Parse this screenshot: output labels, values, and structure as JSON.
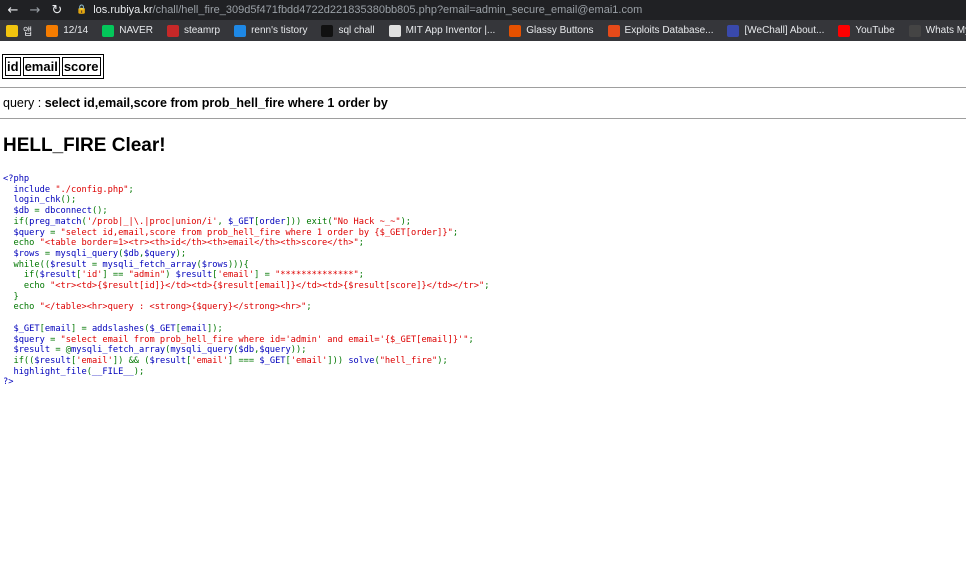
{
  "browser": {
    "url_host": "los.rubiya.kr",
    "url_path": "/chall/hell_fire_309d5f471fbdd4722d221835380bb805.php?email=admin_secure_email@emai1.com",
    "icons": [
      "back-arrow-icon",
      "forward-arrow-icon",
      "reload-icon",
      "lock-icon"
    ]
  },
  "bookmarks": [
    {
      "label": "앱",
      "icon": "apps-grid-icon",
      "color": "#f1c40f"
    },
    {
      "label": "12/14",
      "icon": "blogger-icon",
      "color": "#f57c00"
    },
    {
      "label": "NAVER",
      "icon": "naver-icon",
      "color": "#03c75a"
    },
    {
      "label": "steamrp",
      "icon": "steam-icon",
      "color": "#c62828"
    },
    {
      "label": "renn's tistory",
      "icon": "tistory-icon",
      "color": "#1e88e5"
    },
    {
      "label": "sql chall",
      "icon": "z-icon",
      "color": "#111111"
    },
    {
      "label": "MIT App Inventor |...",
      "icon": "app-inventor-icon",
      "color": "#e0e0e0"
    },
    {
      "label": "Glassy Buttons",
      "icon": "glassy-icon",
      "color": "#e65100"
    },
    {
      "label": "Exploits Database...",
      "icon": "exploitdb-icon",
      "color": "#e64a19"
    },
    {
      "label": "[WeChall] About...",
      "icon": "wechall-icon",
      "color": "#3949ab"
    },
    {
      "label": "YouTube",
      "icon": "youtube-icon",
      "color": "#ff0000"
    },
    {
      "label": "Whats My IP Addr...",
      "icon": "whatsmyip-icon",
      "color": "#444444"
    }
  ],
  "table": {
    "headers": [
      "id",
      "email",
      "score"
    ]
  },
  "query": {
    "label": "query : ",
    "value": "select id,email,score from prob_hell_fire where 1 order by"
  },
  "heading": "HELL_FIRE Clear!",
  "source_lines": [
    {
      "seg": [
        [
          "tag",
          "<?php"
        ]
      ]
    },
    {
      "seg": [
        [
          "tag",
          "  include "
        ],
        [
          "str",
          "\"./config.php\""
        ],
        [
          "kw",
          ";"
        ]
      ]
    },
    {
      "seg": [
        [
          "tag",
          "  login_chk"
        ],
        [
          "kw",
          "();"
        ]
      ]
    },
    {
      "seg": [
        [
          "tag",
          "  $db "
        ],
        [
          "kw",
          "= "
        ],
        [
          "tag",
          "dbconnect"
        ],
        [
          "kw",
          "();"
        ]
      ]
    },
    {
      "seg": [
        [
          "kw",
          "  if("
        ],
        [
          "tag",
          "preg_match"
        ],
        [
          "kw",
          "("
        ],
        [
          "str",
          "'/prob|_|\\.|proc|union/i'"
        ],
        [
          "kw",
          ", "
        ],
        [
          "tag",
          "$_GET"
        ],
        [
          "kw",
          "["
        ],
        [
          "tag",
          "order"
        ],
        [
          "kw",
          "])) exit("
        ],
        [
          "str",
          "\"No Hack ~_~\""
        ],
        [
          "kw",
          ");"
        ]
      ]
    },
    {
      "seg": [
        [
          "tag",
          "  $query "
        ],
        [
          "kw",
          "= "
        ],
        [
          "str",
          "\"select id,email,score from prob_hell_fire where 1 order by {$_GET[order]}\""
        ],
        [
          "kw",
          ";"
        ]
      ]
    },
    {
      "seg": [
        [
          "kw",
          "  echo "
        ],
        [
          "str",
          "\"<table border=1><tr><th>id</th><th>email</th><th>score</th>\""
        ],
        [
          "kw",
          ";"
        ]
      ]
    },
    {
      "seg": [
        [
          "tag",
          "  $rows "
        ],
        [
          "kw",
          "= "
        ],
        [
          "tag",
          "mysqli_query"
        ],
        [
          "kw",
          "("
        ],
        [
          "tag",
          "$db"
        ],
        [
          "kw",
          ","
        ],
        [
          "tag",
          "$query"
        ],
        [
          "kw",
          ");"
        ]
      ]
    },
    {
      "seg": [
        [
          "kw",
          "  while(("
        ],
        [
          "tag",
          "$result "
        ],
        [
          "kw",
          "= "
        ],
        [
          "tag",
          "mysqli_fetch_array"
        ],
        [
          "kw",
          "("
        ],
        [
          "tag",
          "$rows"
        ],
        [
          "kw",
          "))){"
        ]
      ]
    },
    {
      "seg": [
        [
          "kw",
          "    if("
        ],
        [
          "tag",
          "$result"
        ],
        [
          "kw",
          "["
        ],
        [
          "str",
          "'id'"
        ],
        [
          "kw",
          "] == "
        ],
        [
          "str",
          "\"admin\""
        ],
        [
          "kw",
          ") "
        ],
        [
          "tag",
          "$result"
        ],
        [
          "kw",
          "["
        ],
        [
          "str",
          "'email'"
        ],
        [
          "kw",
          "] = "
        ],
        [
          "str",
          "\"**************\""
        ],
        [
          "kw",
          ";"
        ]
      ]
    },
    {
      "seg": [
        [
          "kw",
          "    echo "
        ],
        [
          "str",
          "\"<tr><td>{$result[id]}</td><td>{$result[email]}</td><td>{$result[score]}</td></tr>\""
        ],
        [
          "kw",
          ";"
        ]
      ]
    },
    {
      "seg": [
        [
          "kw",
          "  }"
        ]
      ]
    },
    {
      "seg": [
        [
          "kw",
          "  echo "
        ],
        [
          "str",
          "\"</table><hr>query : <strong>{$query}</strong><hr>\""
        ],
        [
          "kw",
          ";"
        ]
      ]
    },
    {
      "seg": [
        [
          "tag",
          " "
        ]
      ]
    },
    {
      "seg": [
        [
          "tag",
          "  $_GET"
        ],
        [
          "kw",
          "["
        ],
        [
          "tag",
          "email"
        ],
        [
          "kw",
          "] = "
        ],
        [
          "tag",
          "addslashes"
        ],
        [
          "kw",
          "("
        ],
        [
          "tag",
          "$_GET"
        ],
        [
          "kw",
          "["
        ],
        [
          "tag",
          "email"
        ],
        [
          "kw",
          "]);"
        ]
      ]
    },
    {
      "seg": [
        [
          "tag",
          "  $query "
        ],
        [
          "kw",
          "= "
        ],
        [
          "str",
          "\"select email from prob_hell_fire where id='admin' and email='{$_GET[email]}'\""
        ],
        [
          "kw",
          ";"
        ]
      ]
    },
    {
      "seg": [
        [
          "tag",
          "  $result "
        ],
        [
          "kw",
          "= @"
        ],
        [
          "tag",
          "mysqli_fetch_array"
        ],
        [
          "kw",
          "("
        ],
        [
          "tag",
          "mysqli_query"
        ],
        [
          "kw",
          "("
        ],
        [
          "tag",
          "$db"
        ],
        [
          "kw",
          ","
        ],
        [
          "tag",
          "$query"
        ],
        [
          "kw",
          "));"
        ]
      ]
    },
    {
      "seg": [
        [
          "kw",
          "  if(("
        ],
        [
          "tag",
          "$result"
        ],
        [
          "kw",
          "["
        ],
        [
          "str",
          "'email'"
        ],
        [
          "kw",
          "]) && ("
        ],
        [
          "tag",
          "$result"
        ],
        [
          "kw",
          "["
        ],
        [
          "str",
          "'email'"
        ],
        [
          "kw",
          "] === "
        ],
        [
          "tag",
          "$_GET"
        ],
        [
          "kw",
          "["
        ],
        [
          "str",
          "'email'"
        ],
        [
          "kw",
          "])) "
        ],
        [
          "tag",
          "solve"
        ],
        [
          "kw",
          "("
        ],
        [
          "str",
          "\"hell_fire\""
        ],
        [
          "kw",
          ");"
        ]
      ]
    },
    {
      "seg": [
        [
          "tag",
          "  highlight_file"
        ],
        [
          "kw",
          "("
        ],
        [
          "tag",
          "__FILE__"
        ],
        [
          "kw",
          ");"
        ]
      ]
    },
    {
      "seg": [
        [
          "tag",
          "?>"
        ]
      ]
    }
  ]
}
